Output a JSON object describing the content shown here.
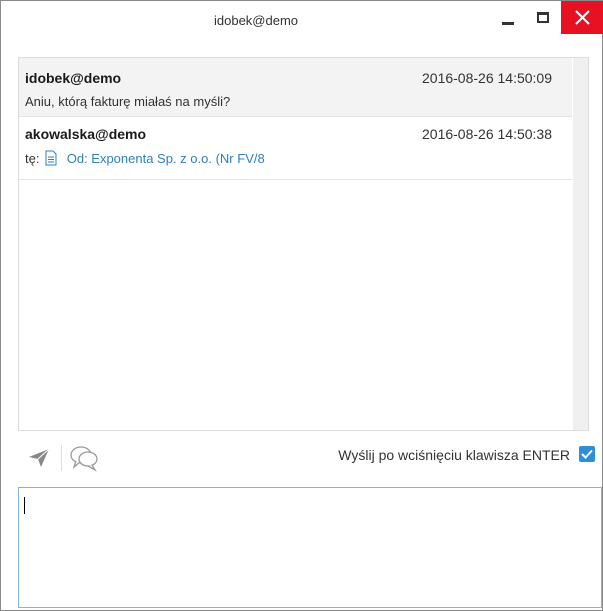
{
  "window": {
    "title": "idobek@demo",
    "controls": {
      "minimize_icon": "minimize-icon",
      "maximize_icon": "maximize-icon",
      "close_icon": "close-icon",
      "close_color": "#e81123"
    }
  },
  "messages": [
    {
      "sender": "idobek@demo",
      "timestamp": "2016-08-26 14:50:09",
      "text": "Aniu, którą fakturę miałaś na myśli?"
    },
    {
      "sender": "akowalska@demo",
      "timestamp": "2016-08-26 14:50:38",
      "prefix": "tę:",
      "attachment_icon": "document-icon",
      "link_text": "Od: Exponenta Sp. z o.o.  (Nr FV/8"
    }
  ],
  "toolbar": {
    "send_icon": "send-icon",
    "chat_icon": "chat-bubbles-icon",
    "enter_label": "Wyślij po wciśnięciu klawisza ENTER",
    "enter_checked": true,
    "accent_color": "#2e8fd8"
  },
  "input": {
    "value": ""
  }
}
